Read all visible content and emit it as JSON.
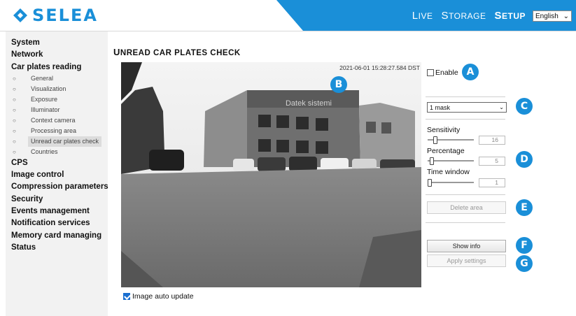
{
  "header": {
    "logo_text": "SELEA",
    "brand_color": "#1a8fd8",
    "nav": [
      {
        "cap": "L",
        "rest": "IVE",
        "active": false
      },
      {
        "cap": "S",
        "rest": "TORAGE",
        "active": false
      },
      {
        "cap": "S",
        "rest": "ETUP",
        "active": true
      }
    ],
    "language": "English"
  },
  "sidebar": {
    "items": [
      {
        "label": "System"
      },
      {
        "label": "Network"
      },
      {
        "label": "Car plates reading"
      }
    ],
    "sub_items": [
      {
        "label": "General"
      },
      {
        "label": "Visualization"
      },
      {
        "label": "Exposure"
      },
      {
        "label": "Illuminator"
      },
      {
        "label": "Context camera"
      },
      {
        "label": "Processing area"
      },
      {
        "label": "Unread car plates check",
        "active": true
      },
      {
        "label": "Countries"
      }
    ],
    "items_after": [
      {
        "label": "CPS"
      },
      {
        "label": "Image control"
      },
      {
        "label": "Compression parameters"
      },
      {
        "label": "Security"
      },
      {
        "label": "Events management"
      },
      {
        "label": "Notification services"
      },
      {
        "label": "Memory card managing"
      },
      {
        "label": "Status"
      }
    ]
  },
  "main": {
    "title_cap": "U",
    "title_rest": "NREAD CAR PLATES CHECK",
    "camera": {
      "timestamp": "2021-06-01 15:28:27.584 DST",
      "building_sign": "Datek sistemi"
    },
    "auto_update_label": "Image auto update",
    "auto_update_checked": true
  },
  "panel": {
    "enable_label": "Enable",
    "mask_value": "1 mask",
    "sliders": [
      {
        "label": "Sensitivity",
        "value": "16",
        "fraction": 0.16
      },
      {
        "label": "Percentage",
        "value": "5",
        "fraction": 0.05
      },
      {
        "label": "Time window",
        "value": "1",
        "fraction": 0.0
      }
    ],
    "delete_area_label": "Delete area",
    "show_info_label": "Show info",
    "apply_settings_label": "Apply settings"
  },
  "badges": [
    "A",
    "B",
    "C",
    "D",
    "E",
    "F",
    "G"
  ]
}
